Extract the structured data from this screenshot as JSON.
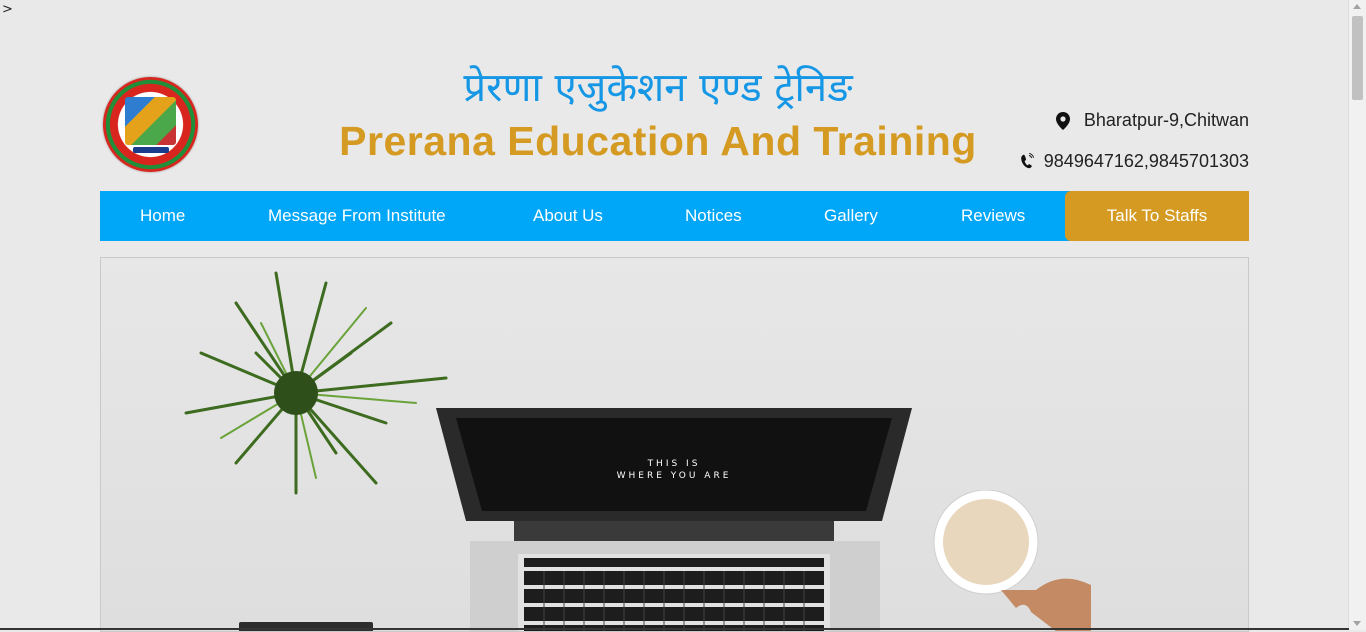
{
  "corner_glyph": ">",
  "header": {
    "title_nepali": "प्रेरणा एजुकेशन एण्ड ट्रेनिङ",
    "title_english": "Prerana Education And Training",
    "address": "Bharatpur-9,Chitwan",
    "phone": "9849647162,9845701303"
  },
  "nav": {
    "items": [
      {
        "label": "Home"
      },
      {
        "label": "Message From Institute"
      },
      {
        "label": "About Us"
      },
      {
        "label": "Notices"
      },
      {
        "label": "Gallery"
      },
      {
        "label": "Reviews"
      }
    ],
    "cta_label": "Talk To Staffs"
  },
  "hero": {
    "screen_line1": "THIS IS",
    "screen_line2": "WHERE YOU ARE"
  },
  "colors": {
    "nav_blue": "#00a6f7",
    "accent_gold": "#d49a22",
    "title_blue": "#1597e6",
    "page_bg": "#e9e9e9"
  },
  "icons": [
    "location-pin-icon",
    "phone-icon"
  ]
}
